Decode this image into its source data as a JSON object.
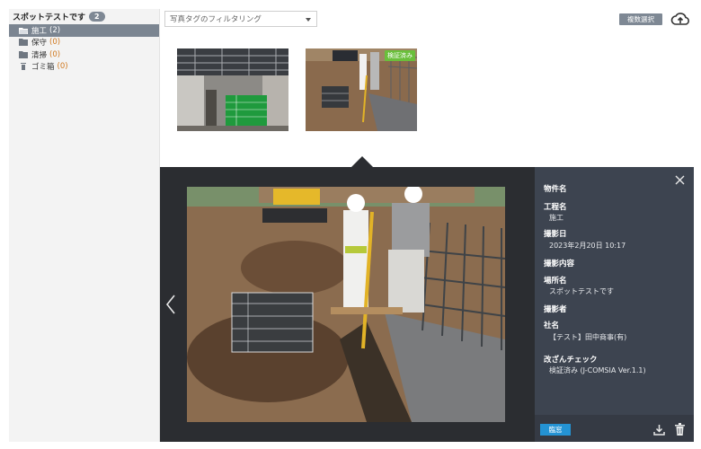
{
  "sidebar": {
    "project_name": "スポットテストです",
    "project_count": "2",
    "folders": [
      {
        "label": "施工",
        "count": "(2)",
        "icon": "folder-open-icon"
      },
      {
        "label": "保守",
        "count": "(0)",
        "icon": "folder-icon"
      },
      {
        "label": "清掃",
        "count": "(0)",
        "icon": "folder-icon"
      },
      {
        "label": "ゴミ箱",
        "count": "(0)",
        "icon": "trash-icon"
      }
    ]
  },
  "toolbar": {
    "filter_placeholder": "写真タグのフィルタリング",
    "multi_select_label": "複数選択"
  },
  "thumbnails": [
    {
      "badge": ""
    },
    {
      "badge": "検証済み"
    }
  ],
  "details": {
    "fields": [
      {
        "label": "物件名",
        "value": ""
      },
      {
        "label": "工程名",
        "value": "施工"
      },
      {
        "label": "撮影日",
        "value": "2023年2月20日 10:17"
      },
      {
        "label": "撮影内容",
        "value": ""
      },
      {
        "label": "場所名",
        "value": "スポットテストです"
      },
      {
        "label": "撮影者",
        "value": ""
      },
      {
        "label": "社名",
        "value": "【テスト】田中商事(有)"
      },
      {
        "label": "改ざんチェック",
        "value": "検証済み (J-COMSIA Ver.1.1)"
      }
    ],
    "approve_label": "臨窓"
  },
  "colors": {
    "sidebar_active": "#7b8591",
    "viewer_bg": "#2b2d31",
    "details_bg": "#3d4450",
    "approve": "#2493d4",
    "verified": "#6abf3b"
  }
}
